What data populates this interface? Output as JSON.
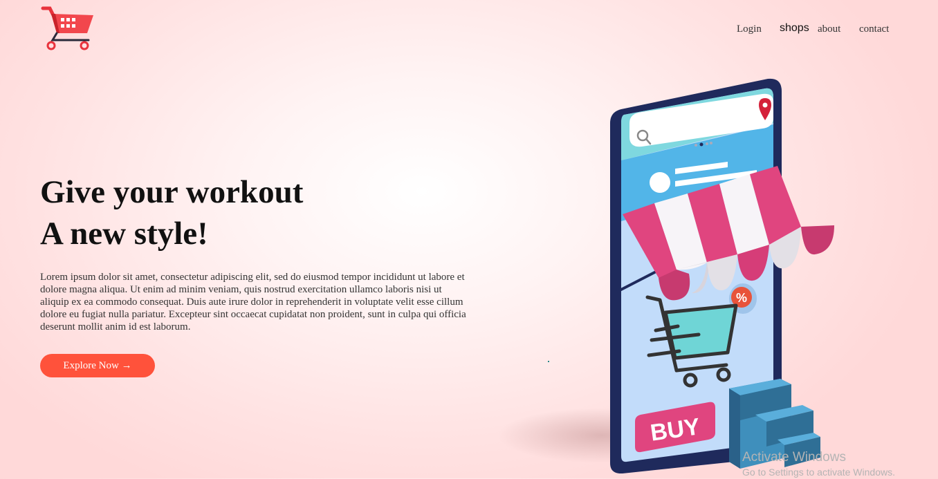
{
  "nav": {
    "links": [
      "Login",
      "shops",
      "about",
      "contact"
    ]
  },
  "hero": {
    "title_line1": "Give your workout",
    "title_line2": "A new style!",
    "paragraph": "Lorem ipsum dolor sit amet, consectetur adipiscing elit, sed do eiusmod tempor incididunt ut labore et dolore magna aliqua. Ut enim ad minim veniam, quis nostrud exercitation ullamco laboris nisi ut aliquip ex ea commodo consequat. Duis aute irure dolor in reprehenderit in voluptate velit esse cillum dolore eu fugiat nulla pariatur. Excepteur sint occaecat cupidatat non proident, sunt in culpa qui officia deserunt mollit anim id est laborum.",
    "cta_label": "Explore Now →"
  },
  "illustration": {
    "buy_label": "BUY",
    "percent_label": "%"
  },
  "watermark": {
    "line1": "Activate Windows",
    "line2": "Go to Settings to activate Windows."
  },
  "colors": {
    "accent": "#ff523b",
    "background": "#ffe2e2",
    "awning_pink": "#e0457f",
    "phone_frame": "#1f2a5c"
  },
  "icons": [
    "shopping-cart-logo-icon",
    "search-icon",
    "location-pin-icon",
    "percent-badge-icon",
    "cart-icon"
  ]
}
